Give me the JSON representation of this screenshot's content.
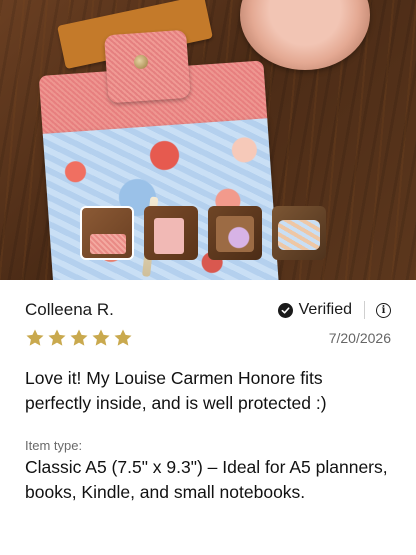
{
  "photo": {
    "thumbnails": [
      {
        "name": "thumbnail-1",
        "active": true
      },
      {
        "name": "thumbnail-2",
        "active": false
      },
      {
        "name": "thumbnail-3",
        "active": false
      },
      {
        "name": "thumbnail-4",
        "active": false
      }
    ]
  },
  "review": {
    "reviewer": "Colleena R.",
    "verified_label": "Verified",
    "rating": 5,
    "rating_max": 5,
    "star_color": "#c9a94e",
    "date": "7/20/2026",
    "body": "Love it!  My Louise Carmen Honore fits perfectly inside, and is well protected :)",
    "item_type_label": "Item type:",
    "item_type_value": "Classic A5 (7.5\" x 9.3\") – Ideal for A5 planners, books, Kindle, and small notebooks."
  },
  "icons": {
    "verified": "check-circle-icon",
    "info": "info-icon",
    "star": "star-icon"
  }
}
